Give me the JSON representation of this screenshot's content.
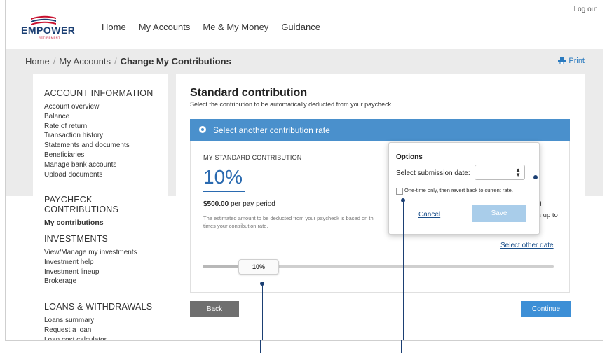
{
  "header": {
    "logo_text": "EMPOWER",
    "logo_sub": "RETIREMENT",
    "nav": [
      "Home",
      "My Accounts",
      "Me & My Money",
      "Guidance"
    ],
    "logout": "Log out"
  },
  "breadcrumb": {
    "home": "Home",
    "accounts": "My Accounts",
    "current": "Change My Contributions"
  },
  "print_label": "Print",
  "sidebar": {
    "account_info": {
      "heading": "ACCOUNT INFORMATION",
      "items": [
        "Account overview",
        "Balance",
        "Rate of return",
        "Transaction history",
        "Statements and documents",
        "Beneficiaries",
        "Manage bank accounts",
        "Upload documents"
      ]
    },
    "paycheck": {
      "heading": "PAYCHECK CONTRIBUTIONS",
      "items": [
        "My contributions"
      ]
    },
    "investments": {
      "heading": "INVESTMENTS",
      "items": [
        "View/Manage my investments",
        "Investment help",
        "Investment lineup",
        "Brokerage"
      ]
    },
    "loans": {
      "heading": "LOANS & WITHDRAWALS",
      "items": [
        "Loans summary",
        "Request a loan",
        "Loan cost calculator"
      ]
    }
  },
  "main": {
    "title": "Standard contribution",
    "subtitle": "Select the contribution to be automatically deducted from your paycheck.",
    "option_label": "Select another contribution rate",
    "section_label": "MY STANDARD CONTRIBUTION",
    "percent": "10%",
    "amount_value": "$500.00",
    "amount_suffix": "per pay period",
    "estimate_text": "The estimated amount to be deducted from your paycheck is based on th",
    "estimate_text2": "times your contribution rate.",
    "right_fragment_1": "nd",
    "right_fragment_2": "es up to",
    "select_other_date": "Select other date",
    "slider_value_label": "10%",
    "slider_fraction": 0.18,
    "back_label": "Back",
    "continue_label": "Continue"
  },
  "popup": {
    "title": "Options",
    "date_label": "Select submission date:",
    "date_value": "",
    "checkbox_label": "One-time only, then revert back to current rate.",
    "checkbox_checked": false,
    "cancel_label": "Cancel",
    "save_label": "Save"
  },
  "colors": {
    "brand_blue": "#1b3f73",
    "accent_blue": "#4a90cc",
    "link_blue": "#1b4f8a",
    "continue_blue": "#3d8fd6",
    "save_disabled": "#a9cdea",
    "back_grey": "#6f6f6f"
  }
}
